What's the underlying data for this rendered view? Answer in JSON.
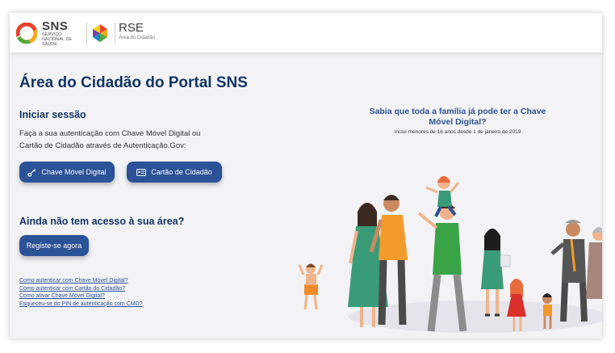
{
  "header": {
    "sns_title": "SNS",
    "sns_subtitle": "SERVIÇO NACIONAL DE SAÚDE",
    "rse_title": "RSE",
    "rse_subtitle": "Área do Cidadão"
  },
  "main": {
    "page_title": "Área do Cidadão do Portal SNS",
    "login_title": "Iniciar sessão",
    "login_intro": "Faça a sua autenticação com Chave Móvel Digital ou Cartão de Cidadão através de Autenticação.Gov:",
    "cmd_button": "Chave Móvel Digital",
    "cc_button": "Cartão de Cidadão",
    "register_title": "Ainda não tem acesso à sua área?",
    "register_button": "Registe-se agora",
    "help_links": [
      "Como autenticar com Chave Móvel Digital?",
      "Como autenticar com Cartão do Cidadão?",
      "Como ativar Chave Móvel Digital?",
      "Esqueceu-se do PIN de autenticação com CMD?"
    ]
  },
  "promo": {
    "title": "Sabia que toda a família já pode ter a Chave Móvel Digital?",
    "subtitle": "Inclui menores de 16 anos desde 1 de janeiro de 2019"
  },
  "colors": {
    "navy": "#123465",
    "button_blue": "#2b5196",
    "background": "#f3f3f5"
  },
  "icons": [
    "sns-logo-icon",
    "rse-logo-icon",
    "key-icon",
    "id-card-icon",
    "family-illustration"
  ]
}
